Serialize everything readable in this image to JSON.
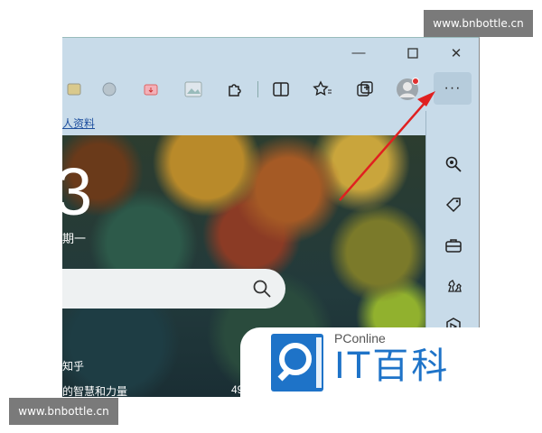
{
  "watermark": {
    "text": "www.bnbottle.cn"
  },
  "titlebar": {
    "minimize": "—",
    "maximize": "☐",
    "close": "✕"
  },
  "toolbar": {
    "more_label": "···"
  },
  "favorites": {
    "link": "人资料"
  },
  "newtab": {
    "date_number": "3",
    "weekday": "期一",
    "news_source": "知乎",
    "news_title": "的智慧和力量",
    "news_count": "49"
  },
  "logo": {
    "brand": "PConline",
    "name": "IT百科"
  },
  "colors": {
    "chrome": "#c8dbe9",
    "accent": "#1e73c8",
    "annotation": "#e02020"
  }
}
